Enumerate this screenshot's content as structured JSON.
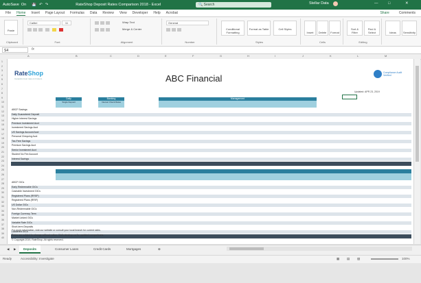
{
  "window": {
    "autosave": "AutoSave",
    "autosave_state": "On",
    "title": "RateShop Deposit Rates Comparison 2018 - Excel",
    "search": "Search",
    "user": "Stellar Data",
    "share": "Share",
    "comments": "Comments"
  },
  "menu": [
    "File",
    "Home",
    "Insert",
    "Page Layout",
    "Formulas",
    "Data",
    "Review",
    "View",
    "Developer",
    "Help",
    "Acrobat"
  ],
  "ribbon": {
    "clipboard": "Clipboard",
    "paste": "Paste",
    "font": "Font",
    "font_name": "Calibri",
    "font_size": "11",
    "alignment": "Alignment",
    "wrap_text": "Wrap Text",
    "merge_center": "Merge & Center",
    "number": "Number",
    "number_format": "General",
    "styles": "Styles",
    "conditional_formatting": "Conditional Formatting",
    "format_as_table": "Format as Table",
    "cell_styles": "Cell Styles",
    "cells": "Cells",
    "insert": "Insert",
    "delete": "Delete",
    "format": "Format",
    "editing": "Editing",
    "sort_filter": "Sort & Filter",
    "find_select": "Find & Select",
    "ideas": "Ideas",
    "sensitivity": "Sensitivity"
  },
  "formula_bar": {
    "name_box": "S4",
    "fx": "fx",
    "formula": ""
  },
  "sheet": {
    "logo_a": "Rate",
    "logo_b": "Shop",
    "logo_sub": "Canada's best rates & brokers",
    "title": "ABC Financial",
    "badge": "Compliance Audit Verified",
    "date": "Updated: APR 23, 2019",
    "sec1": {
      "h1": "Daily",
      "h1b": "Single\nDeposit",
      "h2": "Banking",
      "h2b": "Interest\nCheck Rates",
      "h3": "Management"
    },
    "rows1": [
      "ABCF Savings",
      "Daily Guaranteed Deposit",
      "Higher Interest Savings",
      "Premium Investment Acct",
      "Investment Savings Acct",
      "US Savings Account Acct",
      "Personal Chequing Acct",
      "Tax-Free Savings",
      "Premium Savings Acct",
      "Senior Investment Acct",
      "Student No Fee Account",
      "Interest Savings"
    ],
    "rows2": [
      "ABCF GICs",
      "Early Redeemable GICs",
      "Cashable Investment GICs",
      "Registered Plans (RRSP)",
      "Registered Plans (RRIF)",
      "US Dollar GICs",
      "Non-Redeemable GICs",
      "Foreign Currency Term",
      "Market Linked GICs",
      "Variable Rate GICs",
      "Short-term Deposits",
      "Laddered GICs"
    ],
    "foot1": "For more information, visit our website or consult your local branch for current rates.",
    "foot2": "Rates are subject to change without notice. Visit rateshop.ca for updated comparisons.",
    "foot3": "© Copyright 2019, RateShop. All rights reserved."
  },
  "tabs": [
    "Deposits",
    "Consumer Loans",
    "Credit Cards",
    "Mortgages"
  ],
  "active_tab": "Deposits",
  "status": {
    "left": "Ready",
    "accessibility": "Accessibility: Investigate",
    "zoom": "100%"
  }
}
